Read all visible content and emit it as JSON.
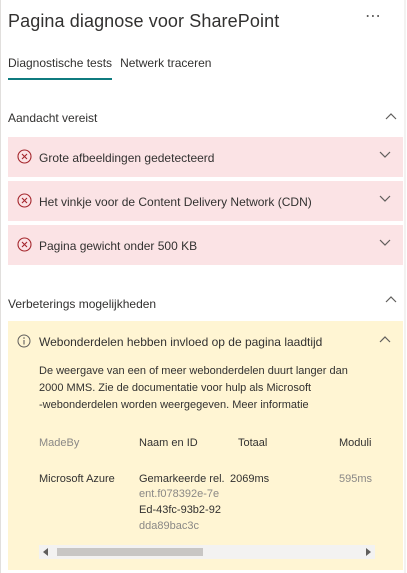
{
  "header": {
    "title": "Pagina diagnose voor SharePoint",
    "more_label": "⋯"
  },
  "tabs": [
    {
      "label": "Diagnostische tests",
      "active": true
    },
    {
      "label": "Netwerk traceren",
      "active": false
    }
  ],
  "sections": {
    "attention": {
      "title": "Aandacht vereist",
      "items": [
        {
          "label": "Grote afbeeldingen gedetecteerd"
        },
        {
          "label": "Het vinkje voor de Content Delivery Network (CDN)"
        },
        {
          "label": "Pagina gewicht onder 500 KB"
        }
      ]
    },
    "improvements": {
      "title": "Verbeterings mogelijkheden",
      "item": {
        "label": "Webonderdelen hebben invloed op de pagina laadtijd",
        "description_lines": [
          "De weergave van een of meer webonderdelen duurt langer dan",
          "2000 MMS. Zie de documentatie voor hulp als Microsoft",
          "-webonderdelen worden weergegeven. Meer informatie"
        ],
        "table": {
          "headers": [
            "MadeBy",
            "Naam en ID",
            "Totaal",
            "Moduli"
          ],
          "row": {
            "made_by": "Microsoft Azure",
            "name": "Gemarkeerde rel.",
            "id_lines": [
              "ent.f078392e-7e",
              "Ed-43fc-93b2-92",
              "dda89bac3c"
            ],
            "total": "2069ms",
            "modules": "595ms"
          }
        }
      }
    }
  },
  "colors": {
    "error_bg": "#fbe3e5",
    "warning_bg": "#fff5d3",
    "error_icon": "#a4262c",
    "tab_underline": "#0f7b7f"
  }
}
